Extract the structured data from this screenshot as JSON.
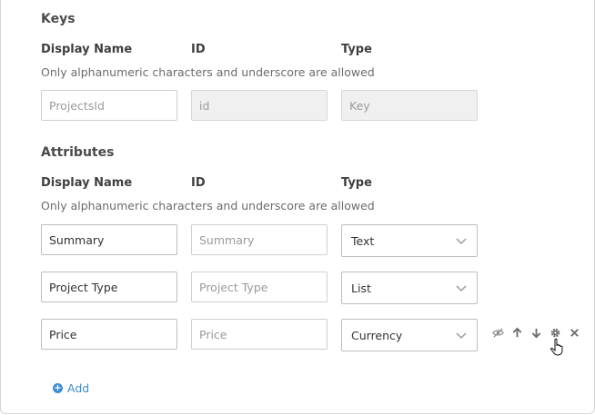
{
  "keys": {
    "title": "Keys",
    "headers": {
      "display_name": "Display Name",
      "id": "ID",
      "type": "Type"
    },
    "hint": "Only alphanumeric characters and underscore are allowed",
    "row": {
      "display_name_placeholder": "ProjectsId",
      "id_value": "id",
      "type_value": "Key"
    }
  },
  "attributes": {
    "title": "Attributes",
    "headers": {
      "display_name": "Display Name",
      "id": "ID",
      "type": "Type"
    },
    "hint": "Only alphanumeric characters and underscore are allowed",
    "rows": [
      {
        "display_name": "Summary",
        "id_placeholder": "Summary",
        "type": "Text"
      },
      {
        "display_name": "Project Type",
        "id_placeholder": "Project Type",
        "type": "List"
      },
      {
        "display_name": "Price",
        "id_placeholder": "Price",
        "type": "Currency"
      }
    ],
    "row_actions": [
      "eye-slash-icon",
      "arrow-up-icon",
      "arrow-down-icon",
      "gear-icon",
      "close-icon"
    ]
  },
  "add": {
    "label": "Add"
  },
  "colors": {
    "accent": "#3d8fd1",
    "border": "#cfcfcf",
    "disabled_bg": "#f0f0f0"
  }
}
